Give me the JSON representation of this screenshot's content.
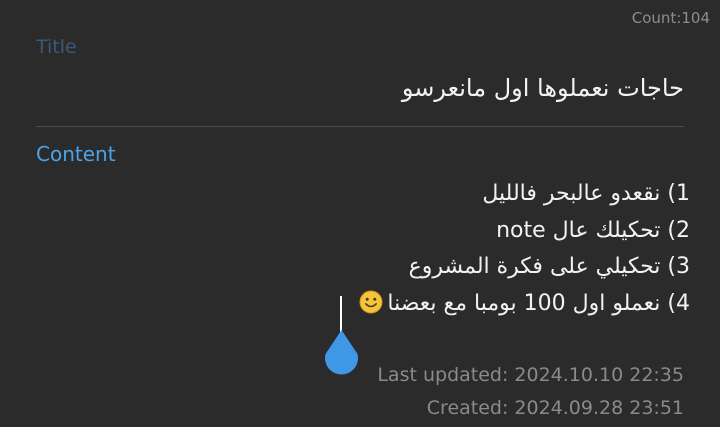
{
  "header": {
    "count_text": "Count:104"
  },
  "title": {
    "label": "Title",
    "value": "حاجات نعملوها اول مانعرسو"
  },
  "content": {
    "label": "Content",
    "lines": [
      "1) نقعدو عالبحر فالليل",
      "2) تحكيلك عال note",
      "3) تحكيلي على فكرة المشروع",
      "4) نعملو اول 100 بومبا مع بعضنا"
    ],
    "line4_emoji": "smiling-face-emoji"
  },
  "meta": {
    "last_updated": "Last updated: 2024.10.10 22:35",
    "created": "Created: 2024.09.28 23:51"
  },
  "colors": {
    "background": "#2b2b2b",
    "accent": "#4aa3e8",
    "title_label": "#3b5a7a",
    "text": "#f2f2f2",
    "meta_text": "#8a8a8a",
    "divider": "#4a4a4a"
  }
}
